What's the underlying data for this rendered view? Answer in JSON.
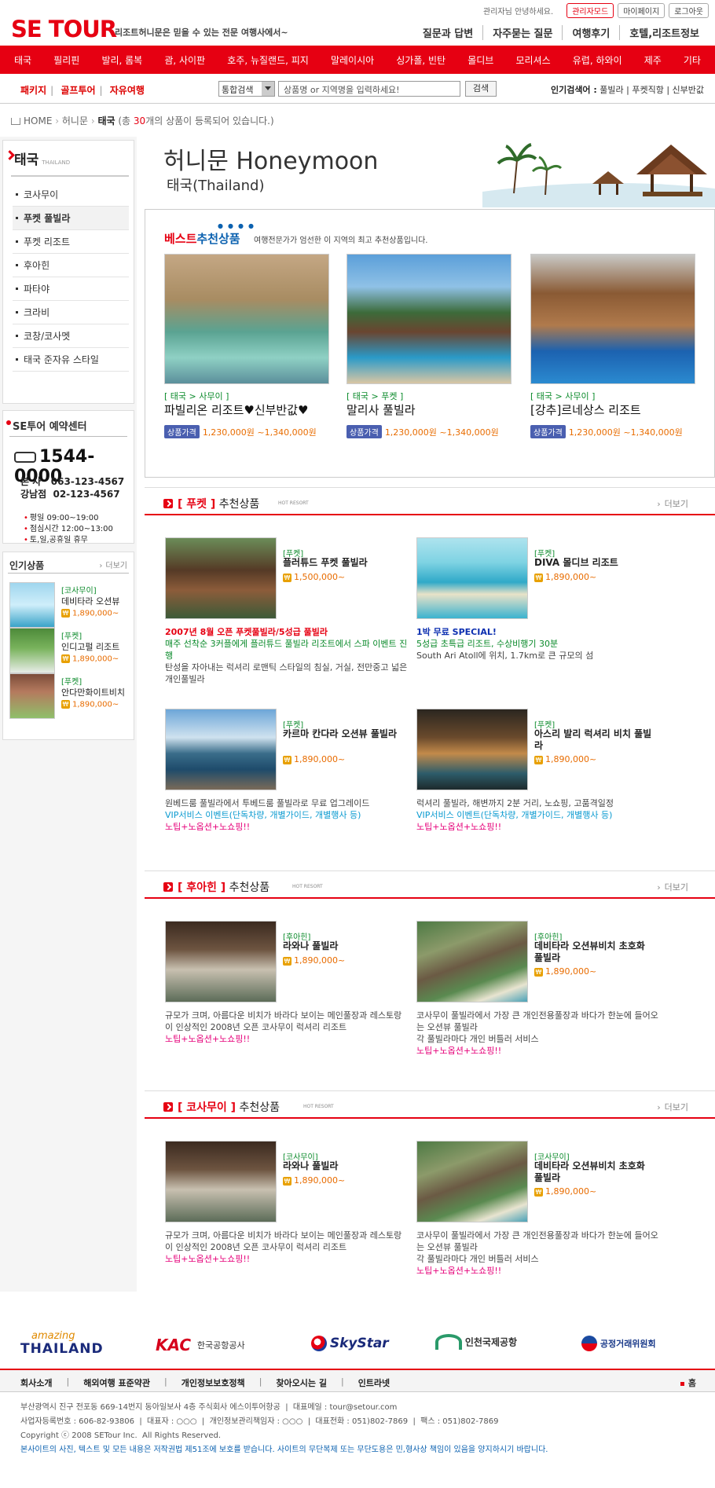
{
  "header": {
    "logo": "SE TOUR",
    "tagline": "리조트허니문은 믿을 수 있는 전문 여행사에서~",
    "greeting": "관리자님 안녕하세요.",
    "admin_btn": "관리자모드",
    "mypage_btn": "마이페이지",
    "logout_btn": "로그아웃",
    "quick": [
      "질문과 답변",
      "자주묻는 질문",
      "여행후기",
      "호텔,리조트정보"
    ]
  },
  "mainnav": [
    "태국",
    "필리핀",
    "발리, 롬복",
    "괌, 사이판",
    "호주, 뉴질랜드, 피지",
    "말레이시아",
    "싱가폴, 빈탄",
    "몰디브",
    "모리셔스",
    "유럽, 하와이",
    "제주",
    "기타"
  ],
  "subbar": {
    "tabs": [
      "패키지",
      "골프투어",
      "자유여행"
    ],
    "search_select": "통합검색",
    "search_placeholder": "상품명 or 지역명을 입력하세요!",
    "search_btn": "검색",
    "popular_label": "인기검색어 :",
    "popular_terms": "풀빌라 | 푸켓직항 | 신부반값"
  },
  "breadcrumb": {
    "home": "HOME",
    "cat": "허니문",
    "current": "태국",
    "pre": "(총 ",
    "count": "30",
    "post": "개의 상품이 등록되어 있습니다.)"
  },
  "sidebar": {
    "title": "태국",
    "title_en": "THAILAND",
    "items": [
      "코사무이",
      "푸켓 풀빌라",
      "푸켓 리조트",
      "후아힌",
      "파타야",
      "크라비",
      "코창/코사멧",
      "태국 준자유 스타일"
    ],
    "reservation": {
      "title": "SE투어 예약센터",
      "phone": "1544-0000",
      "branch1": "본 사   063-123-4567",
      "branch2": "강남점  02-123-4567",
      "hours": [
        "평일 09:00~19:00",
        "점심시간 12:00~13:00",
        "토,일,공휴일 휴무"
      ]
    },
    "popular": {
      "title": "인기상품",
      "more": "더보기",
      "items": [
        {
          "tag": "[코사무이]",
          "name": "데비타라 오션뷰",
          "price": "1,890,000~"
        },
        {
          "tag": "[푸켓]",
          "name": "인디고펄 리조트",
          "price": "1,890,000~"
        },
        {
          "tag": "[푸켓]",
          "name": "안다만화이트비치",
          "price": "1,890,000~"
        }
      ]
    }
  },
  "hero": {
    "title": "허니문 Honeymoon",
    "subtitle": "태국(Thailand)"
  },
  "best": {
    "title_a": "베스트",
    "title_b": "추천상품",
    "desc": "여행전문가가 엄선한 이 지역의 최고 추천상품입니다.",
    "price_label": "상품가격",
    "items": [
      {
        "tag": "[ 태국 > 사무이 ]",
        "name": "파빌리온 리조트♥신부반값♥",
        "price": "1,230,000원 ~1,340,000원"
      },
      {
        "tag": "[ 태국 > 푸켓 ]",
        "name": "말리사 풀빌라",
        "price": "1,230,000원 ~1,340,000원"
      },
      {
        "tag": "[ 태국 > 사무이 ]",
        "name": "[강추]르네상스 리조트",
        "price": "1,230,000원 ~1,340,000원"
      }
    ]
  },
  "sections": [
    {
      "name": "푸켓",
      "label": "추천상품",
      "sub": "HOT RESORT",
      "more": "더보기",
      "items": [
        {
          "tag": "[푸켓]",
          "name": "플러튜드 푸켓 풀빌라",
          "price": "1,500,000~",
          "l1": "2007년 8월 오픈 푸켓풀빌라/5성급 풀빌라",
          "l2": "매주 선착순 3커플에게 플러튜드 풀빌라 리조트에서 스파 이벤트 진행",
          "l3": "탄성을 자아내는 럭셔리 로맨틱 스타일의 침실, 거실, 전만중고 넓은 개인풀빌라"
        },
        {
          "tag": "[푸켓]",
          "name": "DIVA 몰디브 리조트",
          "price": "1,890,000~",
          "l1": "1박 무료 SPECIAL!",
          "l2": "5성급 초특급 리조트, 수상비행기 30분",
          "l3": "South Ari Atoll에 위치, 1.7km로 큰 규모의 섬"
        },
        {
          "tag": "[푸켓]",
          "name": "카르마 칸다라 오션뷰 풀빌라",
          "price": "1,890,000~",
          "l1": "원베드룸 풀빌라에서 투베드룸 풀빌라로 무료 업그레이드",
          "l2": "VIP서비스 이벤트(단독차량, 개별가이드, 개별행사 등)",
          "l3": "노팁+노옵션+노쇼핑!!"
        },
        {
          "tag": "[푸켓]",
          "name": "아스리 발리 럭셔리 비치 풀빌라",
          "price": "1,890,000~",
          "l1": "럭셔리 풀빌라, 해변까지 2분 거리, 노쇼핑, 고품격일정",
          "l2": "VIP서비스 이벤트(단독차량, 개별가이드, 개별행사 등)",
          "l3": "노팁+노옵션+노쇼핑!!"
        }
      ]
    },
    {
      "name": "후아힌",
      "label": "추천상품",
      "sub": "HOT RESORT",
      "more": "더보기",
      "items": [
        {
          "tag": "[후아힌]",
          "name": "라와나 풀빌라",
          "price": "1,890,000~",
          "l1": "규모가 크며, 아름다운 비치가 바라다 보이는 메인풀장과 레스토랑이 인상적인 2008년 오픈 코사무이 럭셔리 리조트",
          "l2": "노팁+노옵션+노쇼핑!!"
        },
        {
          "tag": "[후아힌]",
          "name": "데비타라 오션뷰비치 초호화 풀빌라",
          "price": "1,890,000~",
          "l1": "코사무이 풀빌라에서 가장 큰 개인전용풀장과 바다가 한눈에 들어오는 오션뷰 풀빌라",
          "l1b": "각 풀빌라마다 개인 버틀러 서비스",
          "l2": "노팁+노옵션+노쇼핑!!"
        }
      ]
    },
    {
      "name": "코사무이",
      "label": "추천상품",
      "sub": "HOT RESORT",
      "more": "더보기",
      "items": [
        {
          "tag": "[코사무이]",
          "name": "라와나 풀빌라",
          "price": "1,890,000~",
          "l1": "규모가 크며, 아름다운 비치가 바라다 보이는 메인풀장과 레스토랑이 인상적인 2008년 오픈 코사무이 럭셔리 리조트",
          "l2": "노팁+노옵션+노쇼핑!!"
        },
        {
          "tag": "[코사무이]",
          "name": "데비타라 오션뷰비치 초호화 풀빌라",
          "price": "1,890,000~",
          "l1": "코사무이 풀빌라에서 가장 큰 개인전용풀장과 바다가 한눈에 들어오는 오션뷰 풀빌라",
          "l1b": "각 풀빌라마다 개인 버틀러 서비스",
          "l2": "노팁+노옵션+노쇼핑!!"
        }
      ]
    }
  ],
  "partners": {
    "thailand_a": "amazing",
    "thailand_b": "THAILAND",
    "kac_a": "KAC",
    "kac_b": "한국공항공사",
    "skystar": "SkyStar",
    "incheon": "인천국제공항",
    "ftc": "공정거래위원회"
  },
  "footer": {
    "links": [
      "회사소개",
      "해외여행 표준약관",
      "개인정보보호정책",
      "찾아오시는 길",
      "인트라넷"
    ],
    "home": "홈",
    "address": "부산광역시 진구 전포동 669-14번지 동아일보사 4층 주식회사 에스이투어항공  |  대표메일 : tour@setour.com",
    "biz": "사업자등록번호 : 606-82-93806  |  대표자 : ○○○  |  개인정보관리책임자 : ○○○  |  대표전화 : 051)802-7869  |  팩스 : 051)802-7869",
    "copyright": "Copyright ⓒ 2008 SETour Inc.  All Rights Reserved.",
    "notice": "본사이트의 사진, 텍스트 및 모든 내용은 저작권법 제51조에 보호를 받습니다. 사이트의 무단복제 또는 무단도용은 민,형사상 책임이 있음을 양지하시기 바랍니다."
  }
}
